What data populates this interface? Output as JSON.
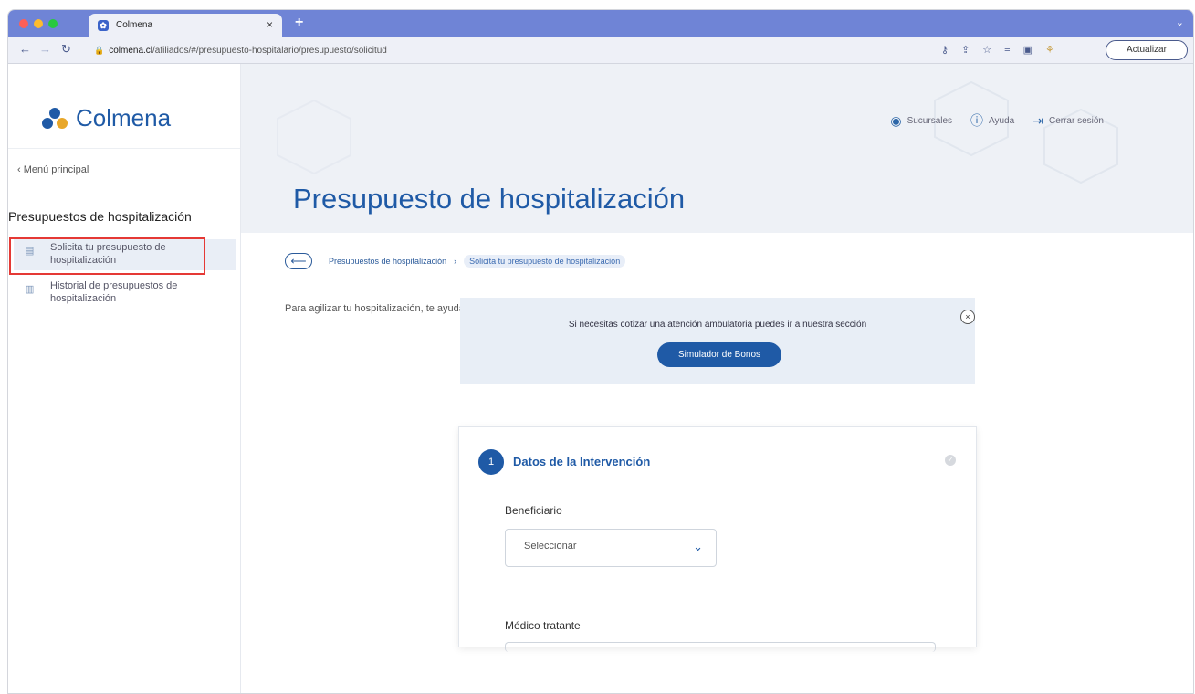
{
  "browser": {
    "tab_title": "Colmena",
    "tab_favicon": "colmena-favicon",
    "new_tab": "+",
    "tab_close": "×",
    "tab_menu": "⌄",
    "url_domain": "colmena.cl",
    "url_path": "/afiliados/#/presupuesto-hospitalario/presupuesto/solicitud",
    "update_button": "Actualizar",
    "colors": {
      "tabbar": "#6f84d6",
      "toolbar": "#eef0f7"
    }
  },
  "header": {
    "logo_text": "Colmena",
    "links": [
      {
        "icon": "location-pin-icon",
        "glyph": "◉",
        "label": "Sucursales"
      },
      {
        "icon": "info-icon",
        "glyph": "ⓘ",
        "label": "Ayuda"
      },
      {
        "icon": "logout-icon",
        "glyph": "⇥",
        "label": "Cerrar sesión"
      }
    ]
  },
  "sidebar": {
    "back_label": "‹ Menú principal",
    "section_title": "Presupuestos de hospitalización",
    "items": [
      {
        "label": "Solicita tu presupuesto de hospitalización",
        "icon": "document-icon",
        "active": true
      },
      {
        "label": "Historial de presupuestos de hospitalización",
        "icon": "history-document-icon",
        "active": false
      }
    ]
  },
  "main": {
    "page_title": "Presupuesto de hospitalización",
    "breadcrumb": {
      "back_glyph": "⟵",
      "items": [
        "Presupuestos de hospitalización",
        "Solicita tu presupuesto de hospitalización"
      ],
      "separator": "›"
    },
    "intro": "Para agilizar tu hospitalización, te ayudamos a encontrar la mejor opción para ti, completa los siguientes datos y te enviaremos nuestra propuesta",
    "banner": {
      "text": "Si necesitas cotizar una atención ambulatoria puedes ir a nuestra sección",
      "button": "Simulador de Bonos",
      "close": "×"
    },
    "form": {
      "step_number": "1",
      "step_title": "Datos de la Intervención",
      "beneficiary_label": "Beneficiario",
      "beneficiary_value": "Seleccionar",
      "doctor_label": "Médico tratante"
    }
  },
  "colors": {
    "brand": "#1f5aa6",
    "highlight_box": "#e53935"
  }
}
